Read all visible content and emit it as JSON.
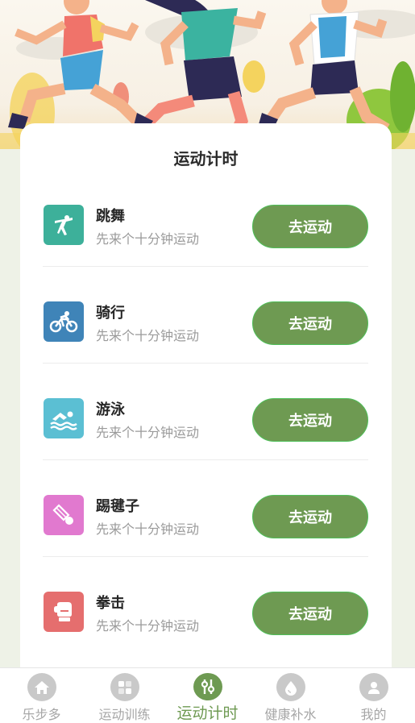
{
  "card": {
    "title": "运动计时"
  },
  "activities": [
    {
      "name": "跳舞",
      "desc": "先来个十分钟运动",
      "button": "去运动",
      "icon": "dancer-icon",
      "color": "#3db09a"
    },
    {
      "name": "骑行",
      "desc": "先来个十分钟运动",
      "button": "去运动",
      "icon": "cyclist-icon",
      "color": "#3f84b8"
    },
    {
      "name": "游泳",
      "desc": "先来个十分钟运动",
      "button": "去运动",
      "icon": "swimmer-icon",
      "color": "#5bbfd3"
    },
    {
      "name": "踢毽子",
      "desc": "先来个十分钟运动",
      "button": "去运动",
      "icon": "shuttlecock-icon",
      "color": "#e179cf"
    },
    {
      "name": "拳击",
      "desc": "先来个十分钟运动",
      "button": "去运动",
      "icon": "boxing-glove-icon",
      "color": "#e56e6e"
    }
  ],
  "tabbar": {
    "items": [
      {
        "label": "乐步多",
        "icon": "home-icon",
        "active": false
      },
      {
        "label": "运动训练",
        "icon": "training-icon",
        "active": false
      },
      {
        "label": "运动计时",
        "icon": "timer-icon",
        "active": true
      },
      {
        "label": "健康补水",
        "icon": "water-drop-icon",
        "active": false
      },
      {
        "label": "我的",
        "icon": "user-icon",
        "active": false
      }
    ]
  },
  "colors": {
    "accent": "#6e9a52",
    "button_border": "#4fbf59",
    "page_background": "#eef2e7"
  }
}
